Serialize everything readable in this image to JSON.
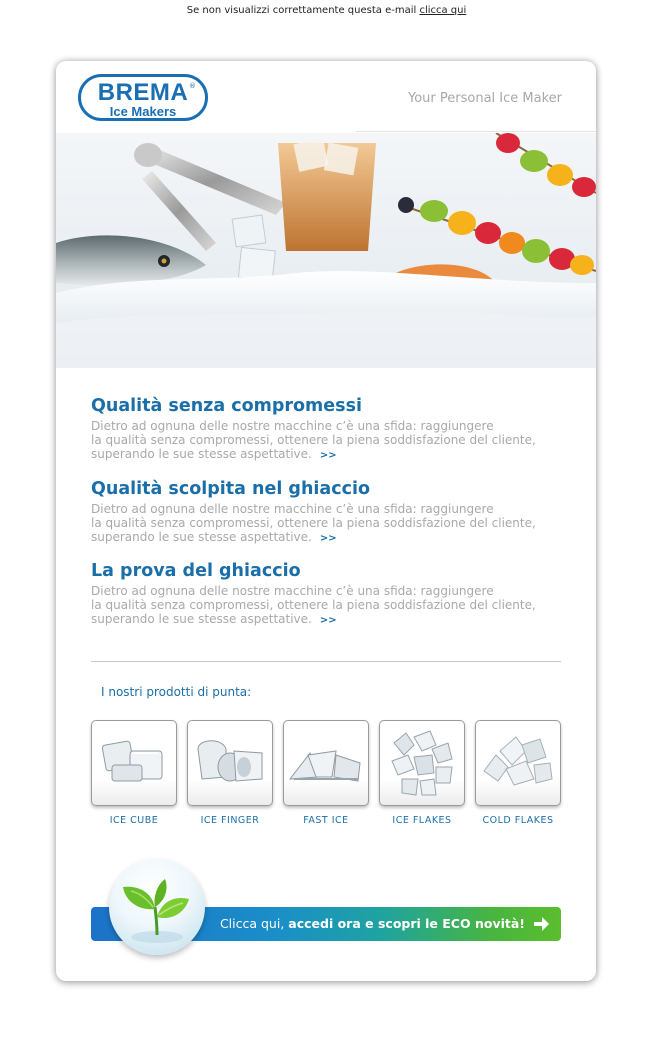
{
  "top_note": {
    "text": "Se non visualizzi correttamente questa e-mail",
    "link": "clicca qui"
  },
  "header": {
    "logo_brand": "BREMA",
    "logo_reg": "®",
    "logo_sub": "Ice Makers",
    "tagline": "Your Personal Ice Maker"
  },
  "articles": [
    {
      "title": "Qualità senza compromessi",
      "body": "Dietro ad ognuna delle nostre macchine c’è una sfida: raggiungere\nla qualità senza compromessi, ottenere la piena soddisfazione del cliente,\nsuperando le sue stesse aspettative.",
      "more": ">>"
    },
    {
      "title": "Qualità scolpita nel ghiaccio",
      "body": "Dietro ad ognuna delle nostre macchine c’è una sfida: raggiungere\nla qualità senza compromessi, ottenere la piena soddisfazione del cliente,\nsuperando le sue stesse aspettative.",
      "more": ">>"
    },
    {
      "title": "La prova del ghiaccio",
      "body": "Dietro ad ognuna delle nostre macchine c’è una sfida: raggiungere\nla qualità senza compromessi, ottenere la piena soddisfazione del cliente,\nsuperando le sue stesse aspettative.",
      "more": ">>"
    }
  ],
  "products": {
    "title": "I nostri prodotti di punta:",
    "items": [
      {
        "label": "ICE CUBE",
        "icon": "ice-cube-icon"
      },
      {
        "label": "ICE FINGER",
        "icon": "ice-finger-icon"
      },
      {
        "label": "FAST ICE",
        "icon": "fast-ice-icon"
      },
      {
        "label": "ICE FLAKES",
        "icon": "ice-flakes-icon"
      },
      {
        "label": "COLD FLAKES",
        "icon": "cold-flakes-icon"
      }
    ]
  },
  "eco": {
    "text_pre": "Clicca qui,",
    "text_bold": "accedi ora e scopri le ECO novità!",
    "icon": "arrow-right-icon"
  },
  "colors": {
    "brand_blue": "#1a6fb3",
    "heading_blue": "#1b6fa8",
    "body_gray": "#a9a9a9",
    "eco_green": "#5cbd2e"
  }
}
